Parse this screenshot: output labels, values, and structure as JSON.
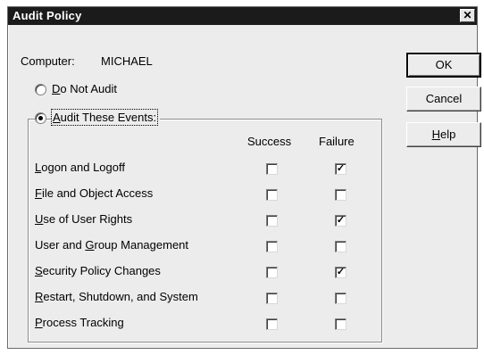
{
  "window": {
    "title": "Audit Policy",
    "close_glyph": "✕"
  },
  "computer": {
    "label": "Computer:",
    "name": "MICHAEL"
  },
  "options": {
    "do_not_audit": {
      "mnemonic": "D",
      "rest": "o Not Audit",
      "selected": false
    },
    "audit_events": {
      "mnemonic": "A",
      "rest": "udit These Events:",
      "selected": true
    }
  },
  "columns": {
    "success": "Success",
    "failure": "Failure"
  },
  "events": [
    {
      "pre": "",
      "mnemonic": "L",
      "rest": "ogon and Logoff",
      "success": false,
      "failure": true
    },
    {
      "pre": "",
      "mnemonic": "F",
      "rest": "ile and Object Access",
      "success": false,
      "failure": false
    },
    {
      "pre": "",
      "mnemonic": "U",
      "rest": "se of User Rights",
      "success": false,
      "failure": true
    },
    {
      "pre": "User and ",
      "mnemonic": "G",
      "rest": "roup Management",
      "success": false,
      "failure": false
    },
    {
      "pre": "",
      "mnemonic": "S",
      "rest": "ecurity Policy Changes",
      "success": false,
      "failure": true
    },
    {
      "pre": "",
      "mnemonic": "R",
      "rest": "estart, Shutdown, and System",
      "success": false,
      "failure": false
    },
    {
      "pre": "",
      "mnemonic": "P",
      "rest": "rocess Tracking",
      "success": false,
      "failure": false
    }
  ],
  "buttons": {
    "ok": "OK",
    "cancel": "Cancel",
    "help": {
      "mnemonic": "H",
      "rest": "elp"
    }
  },
  "check_glyph": "✓"
}
